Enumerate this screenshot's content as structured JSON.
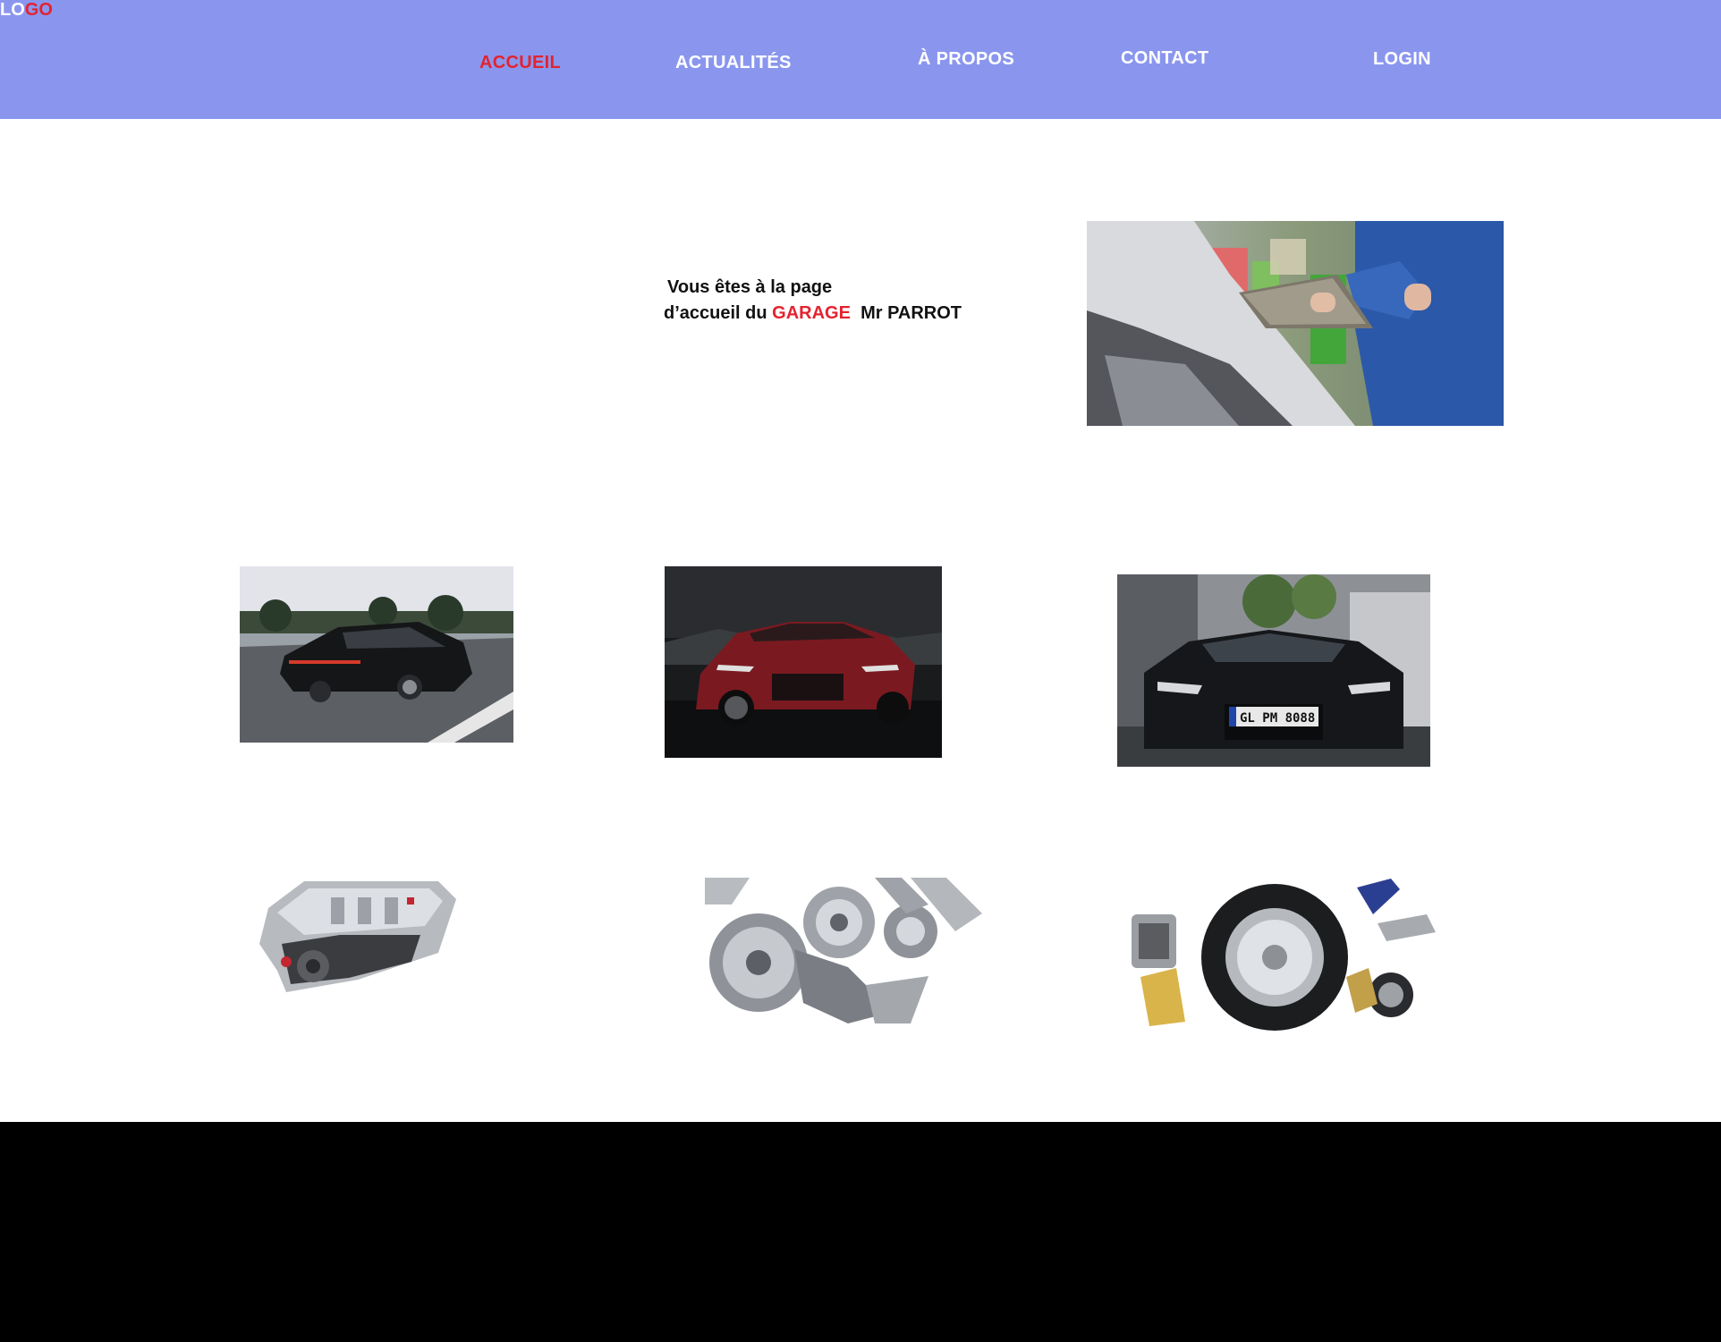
{
  "nav": {
    "logo_part1": "LO",
    "logo_part2": "GO",
    "items": [
      {
        "label": "ACCUEIL"
      },
      {
        "label": "ACTUALITÉS"
      },
      {
        "label": "À PROPOS"
      },
      {
        "label": "CONTACT"
      },
      {
        "label": "LOGIN"
      }
    ]
  },
  "hero": {
    "line1": "Vous êtes à la page",
    "line2_prefix": "d’accueil du ",
    "line2_highlight": "GARAGE",
    "line2_suffix": "  Mr PARROT"
  },
  "colors": {
    "header_bg": "#8a96ee",
    "accent": "#e3232f",
    "footer_bg": "#000000"
  },
  "images": [
    {
      "name": "mechanic-photo"
    },
    {
      "name": "black-sedan-photo"
    },
    {
      "name": "red-sports-car-photo"
    },
    {
      "name": "black-sports-car-photo"
    },
    {
      "name": "engine-block-photo"
    },
    {
      "name": "engine-gears-photo"
    },
    {
      "name": "wheel-and-tools-photo"
    }
  ]
}
